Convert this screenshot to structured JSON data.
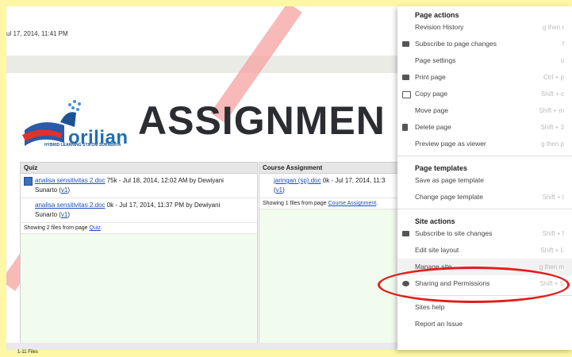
{
  "page": {
    "timestamp": "ul 17, 2014, 11:41 PM",
    "title": "ASSIGNMEN",
    "logo_text": "orilian",
    "logo_subtitle": "HYBRID LEARNING STIKOM SURABAYA"
  },
  "quiz_panel": {
    "header": "Quiz",
    "files": [
      {
        "name": "analisa sensitivitas 2.doc",
        "meta": "75k - Jul 18, 2014, 12:02 AM by Dewiyani",
        "author_line": "Sunarto",
        "version": "v1"
      },
      {
        "name": "analisa sensitivitas 2.doc",
        "meta": "0k - Jul 17, 2014, 11:37 PM by Dewiyani",
        "author_line": "Sunarto",
        "version": "v1"
      }
    ],
    "showing": "Showing 2 files from page",
    "showing_link": "Quiz"
  },
  "course_panel": {
    "header": "Course Assignment",
    "files": [
      {
        "name": "jaringan (sp).doc",
        "meta": "0k - Jul 17, 2014, 11:3",
        "version": "v1"
      }
    ],
    "showing": "Showing 1 files from page",
    "showing_link": "Course Assignment"
  },
  "bottom_strip": "1-11 Files",
  "menu": {
    "page_actions_title": "Page actions",
    "page_actions": [
      {
        "label": "Revision History",
        "shortcut": "g then r",
        "icon": "none"
      },
      {
        "label": "Subscribe to page changes",
        "shortcut": "f",
        "icon": "mail-icon"
      },
      {
        "label": "Page settings",
        "shortcut": "u",
        "icon": "none"
      },
      {
        "label": "Print page",
        "shortcut": "Ctrl + p",
        "icon": "print-icon"
      },
      {
        "label": "Copy page",
        "shortcut": "Shift + c",
        "icon": "copy-icon"
      },
      {
        "label": "Move page",
        "shortcut": "Shift + m",
        "icon": "none"
      },
      {
        "label": "Delete page",
        "shortcut": "Shift + 3",
        "icon": "trash-icon"
      },
      {
        "label": "Preview page as viewer",
        "shortcut": "g then p",
        "icon": "none"
      }
    ],
    "page_templates_title": "Page templates",
    "page_templates": [
      {
        "label": "Save as page template",
        "shortcut": ""
      },
      {
        "label": "Change page template",
        "shortcut": "Shift + t"
      }
    ],
    "site_actions_title": "Site actions",
    "site_actions": [
      {
        "label": "Subscribe to site changes",
        "shortcut": "Shift + f",
        "icon": "mail-icon"
      },
      {
        "label": "Edit site layout",
        "shortcut": "Shift + L",
        "icon": "none"
      },
      {
        "label": "Manage site",
        "shortcut": "g then m",
        "icon": "none"
      },
      {
        "label": "Sharing and Permissions",
        "shortcut": "Shift + S",
        "icon": "person-add-icon"
      }
    ],
    "help": [
      {
        "label": "Sites help"
      },
      {
        "label": "Report an Issue"
      }
    ]
  },
  "colors": {
    "background": "#fdf7a6",
    "highlight_oval": "#e21d1d",
    "green_fill": "#b9f2ab",
    "link": "#1b4fb4"
  }
}
